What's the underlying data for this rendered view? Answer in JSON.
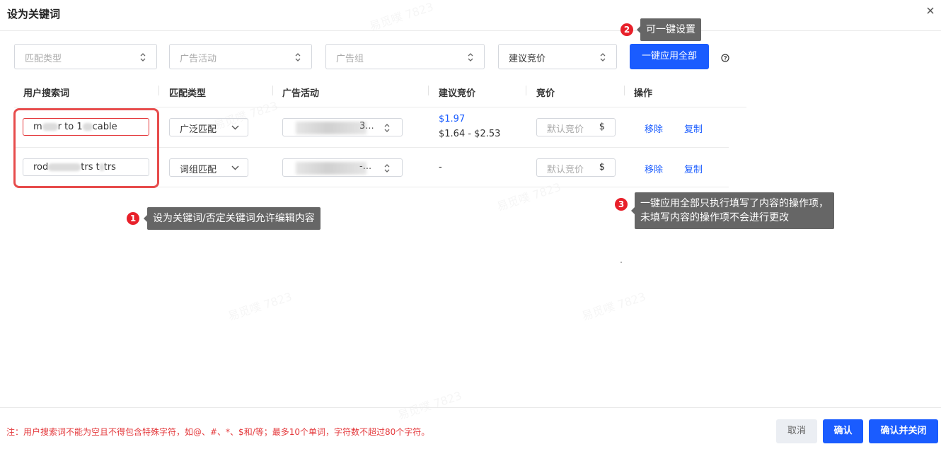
{
  "dialog": {
    "title": "设为关键词"
  },
  "toolbar": {
    "match_type_placeholder": "匹配类型",
    "campaign_placeholder": "广告活动",
    "ad_group_placeholder": "广告组",
    "bid_option": "建议竞价",
    "apply_all_label": "一键应用全部"
  },
  "table": {
    "headers": [
      "用户搜索词",
      "匹配类型",
      "广告活动",
      "建议竞价",
      "竞价",
      "操作"
    ],
    "rows": [
      {
        "keyword_a": "m",
        "keyword_b": "r to 1",
        "keyword_c": "cable",
        "match_type": "广泛匹配",
        "campaign_suffix": "3...",
        "suggested_bid": "$1.97",
        "suggested_range": "$1.64 - $2.53",
        "bid_placeholder": "默认竞价",
        "currency": "$",
        "remove": "移除",
        "copy": "复制"
      },
      {
        "keyword_a": "rod",
        "keyword_b": "trs t",
        "keyword_c": "trs",
        "match_type": "词组匹配",
        "campaign_suffix": "-...",
        "suggested_bid": "-",
        "bid_placeholder": "默认竞价",
        "currency": "$",
        "remove": "移除",
        "copy": "复制"
      }
    ]
  },
  "annotations": [
    {
      "num": "1",
      "text": "设为关键词/否定关键词允许编辑内容"
    },
    {
      "num": "2",
      "text": "可一键设置"
    },
    {
      "num": "3",
      "line1": "一键应用全部只执行填写了内容的操作项，",
      "line2": "未填写内容的操作项不会进行更改"
    }
  ],
  "footer": {
    "note": "注：用户搜索词不能为空且不得包含特殊字符，如@、#、*、$和/等；最多10个单词，字符数不超过80个字符。",
    "cancel": "取消",
    "confirm": "确认",
    "confirm_close": "确认并关闭"
  },
  "watermark": "易觅噗 7823",
  "colors": {
    "primary": "#1a5cff",
    "danger": "#e4393c",
    "tooltip": "#666666"
  }
}
